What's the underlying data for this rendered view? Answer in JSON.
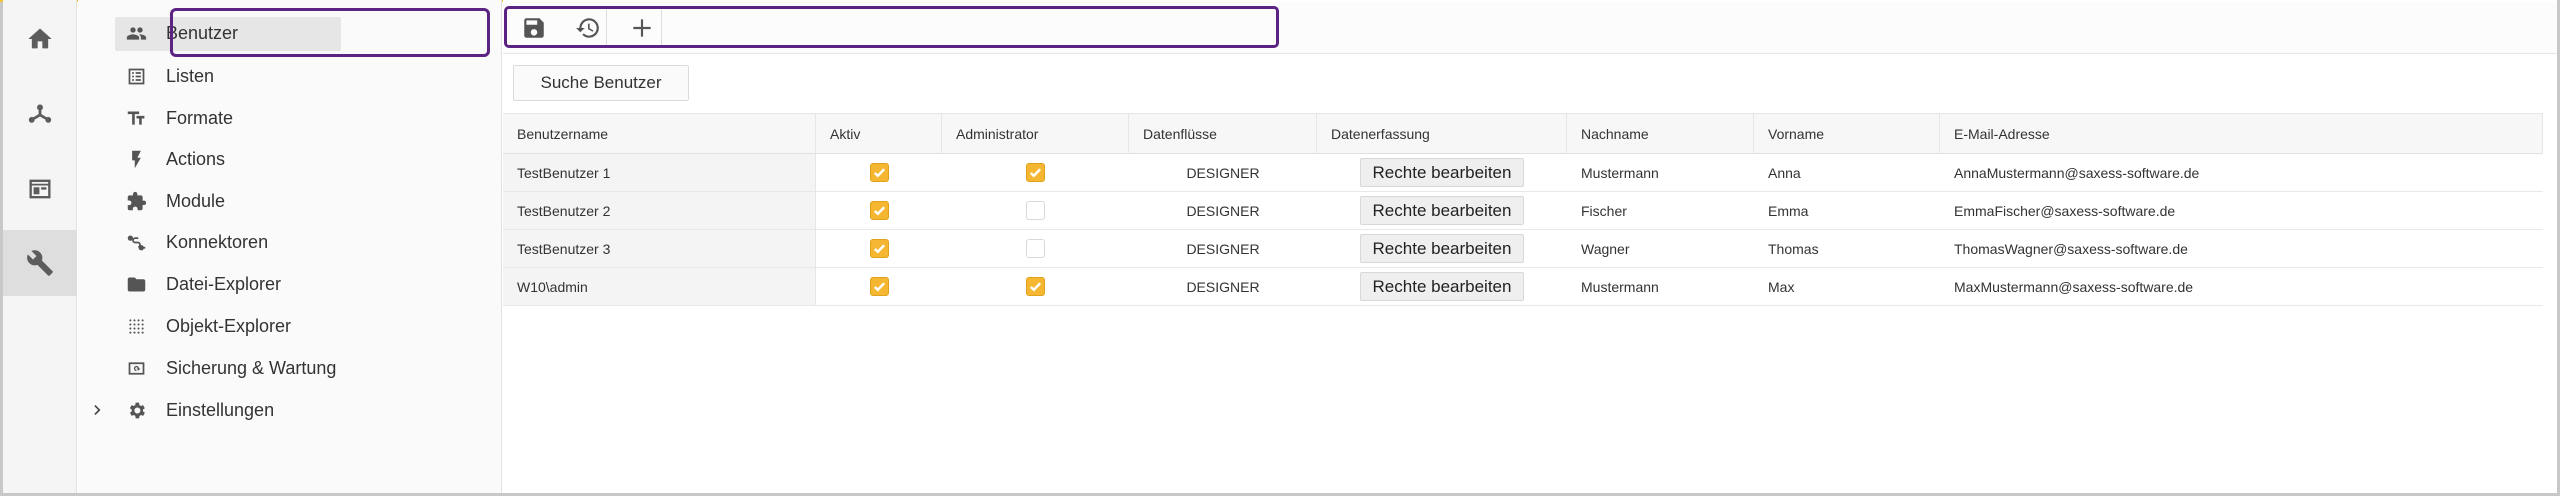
{
  "rail": {
    "items": [
      {
        "icon": "home-icon"
      },
      {
        "icon": "dataflow-icon"
      },
      {
        "icon": "window-icon"
      },
      {
        "icon": "wrench-icon",
        "active": true
      }
    ]
  },
  "sidebar": {
    "items": [
      {
        "label": "Benutzer",
        "icon": "users-icon",
        "selected": true
      },
      {
        "label": "Listen",
        "icon": "list-icon"
      },
      {
        "label": "Formate",
        "icon": "text-format-icon"
      },
      {
        "label": "Actions",
        "icon": "lightning-icon"
      },
      {
        "label": "Module",
        "icon": "puzzle-icon"
      },
      {
        "label": "Konnektoren",
        "icon": "connector-icon"
      },
      {
        "label": "Datei-Explorer",
        "icon": "folder-icon"
      },
      {
        "label": "Objekt-Explorer",
        "icon": "dots-grid-icon"
      },
      {
        "label": "Sicherung & Wartung",
        "icon": "backup-icon"
      },
      {
        "label": "Einstellungen",
        "icon": "gear-icon",
        "expandable": true
      }
    ]
  },
  "toolbar": {
    "buttons": [
      {
        "icon": "save-icon"
      },
      {
        "icon": "restore-icon"
      },
      {
        "icon": "add-icon"
      }
    ]
  },
  "search": {
    "label": "Suche Benutzer"
  },
  "table": {
    "columns": [
      "Benutzername",
      "Aktiv",
      "Administrator",
      "Datenflüsse",
      "Datenerfassung",
      "Nachname",
      "Vorname",
      "E-Mail-Adresse"
    ],
    "rows": [
      {
        "username": "TestBenutzer 1",
        "active": true,
        "admin": true,
        "dataflows": "DESIGNER",
        "capture": "Rechte bearbeiten",
        "lastname": "Mustermann",
        "firstname": "Anna",
        "email": "AnnaMustermann@saxess-software.de"
      },
      {
        "username": "TestBenutzer 2",
        "active": true,
        "admin": false,
        "dataflows": "DESIGNER",
        "capture": "Rechte bearbeiten",
        "lastname": "Fischer",
        "firstname": "Emma",
        "email": "EmmaFischer@saxess-software.de"
      },
      {
        "username": "TestBenutzer 3",
        "active": true,
        "admin": false,
        "dataflows": "DESIGNER",
        "capture": "Rechte bearbeiten",
        "lastname": "Wagner",
        "firstname": "Thomas",
        "email": "ThomasWagner@saxess-software.de"
      },
      {
        "username": "W10\\admin",
        "active": true,
        "admin": true,
        "dataflows": "DESIGNER",
        "capture": "Rechte bearbeiten",
        "lastname": "Mustermann",
        "firstname": "Max",
        "email": "MaxMustermann@saxess-software.de"
      }
    ]
  },
  "colors": {
    "accent": "#f5b731",
    "highlight": "#5b2483",
    "topline": "#f2c230"
  }
}
